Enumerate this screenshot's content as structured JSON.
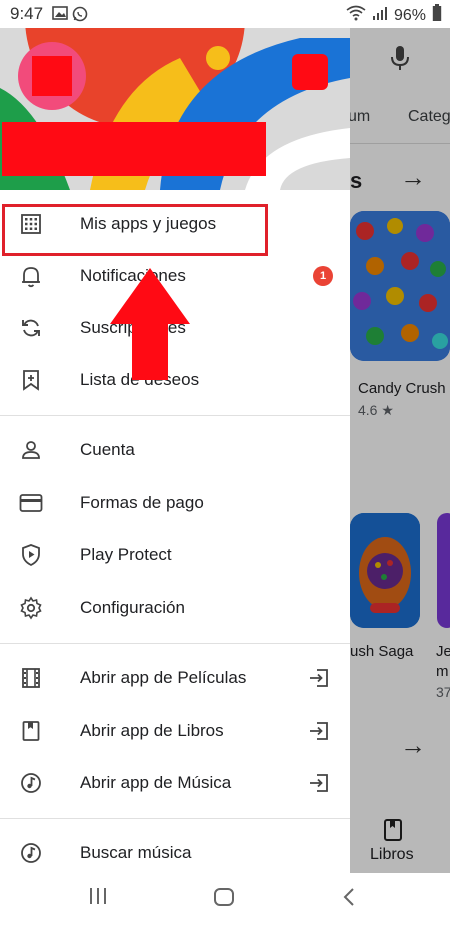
{
  "status_bar": {
    "time": "9:47",
    "battery": "96%",
    "icons": [
      "image-icon",
      "whatsapp-icon",
      "wifi-icon",
      "signal-icon",
      "battery-icon"
    ]
  },
  "background_app": {
    "tabs": [
      "um",
      "Categ"
    ],
    "section_title": "s",
    "app1_title": "Candy Crush S",
    "app1_rating": "4.6 ★",
    "app2_title": "rush Saga",
    "app3_title": "Je",
    "app3_title2": "m",
    "app3_count": "37",
    "bottom_nav_label": "Libros"
  },
  "drawer": {
    "menu_group_1": [
      {
        "label": "Mis apps y juegos",
        "icon": "apps-grid-icon"
      },
      {
        "label": "Notificaciones",
        "icon": "bell-icon",
        "badge": "1"
      },
      {
        "label": "Suscripciones",
        "icon": "refresh-icon"
      },
      {
        "label": "Lista de deseos",
        "icon": "bookmark-add-icon"
      }
    ],
    "menu_group_2": [
      {
        "label": "Cuenta",
        "icon": "person-icon"
      },
      {
        "label": "Formas de pago",
        "icon": "credit-card-icon"
      },
      {
        "label": "Play Protect",
        "icon": "shield-play-icon"
      },
      {
        "label": "Configuración",
        "icon": "gear-icon"
      }
    ],
    "menu_group_3": [
      {
        "label": "Abrir app de Películas",
        "icon": "film-icon"
      },
      {
        "label": "Abrir app de Libros",
        "icon": "book-icon"
      },
      {
        "label": "Abrir app de Música",
        "icon": "music-note-icon"
      }
    ],
    "menu_group_4": [
      {
        "label": "Buscar música",
        "icon": "music-note-icon"
      }
    ]
  },
  "colors": {
    "highlight": "#e0202a",
    "badge": "#ea4335",
    "redaction": "#ff0a14",
    "avatar": "#f24b7b"
  }
}
